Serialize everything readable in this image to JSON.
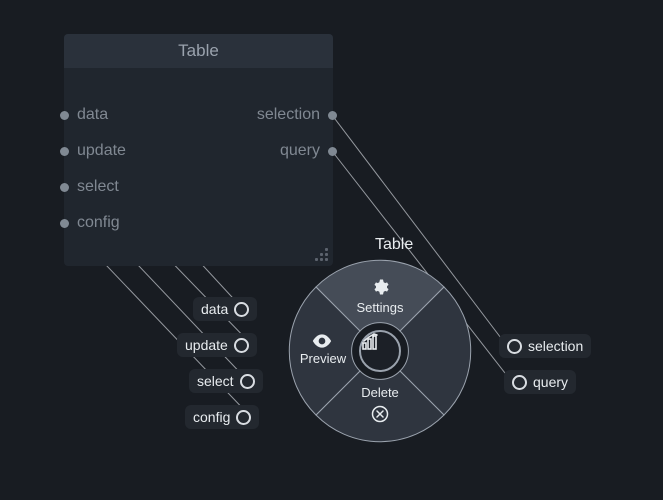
{
  "panel": {
    "title": "Table",
    "ports_left": [
      "data",
      "update",
      "select",
      "config"
    ],
    "ports_right": [
      "selection",
      "query"
    ]
  },
  "pills_left": [
    "data",
    "update",
    "select",
    "config"
  ],
  "pills_right": [
    "selection",
    "query"
  ],
  "radial": {
    "label": "Table",
    "segments": {
      "top": "Settings",
      "left": "Preview",
      "bottom": "Delete"
    }
  }
}
